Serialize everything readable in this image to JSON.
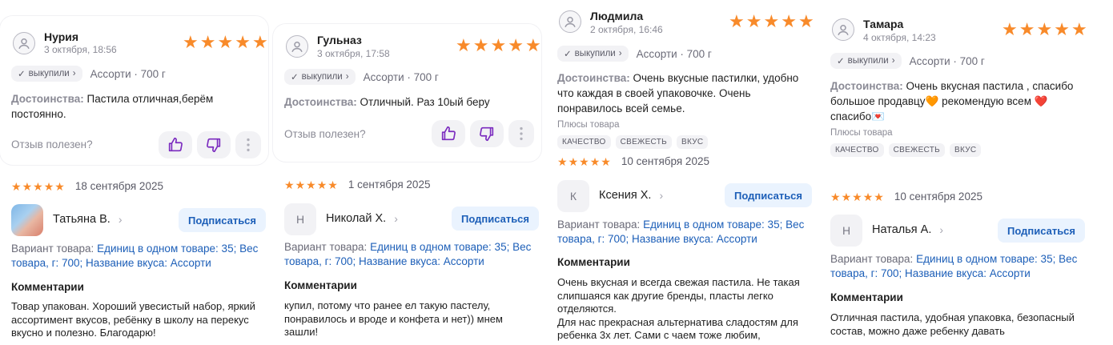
{
  "colors": {
    "star": "#f88a2a",
    "link": "#1d5fb8",
    "subscribe_bg": "#eaf3fe",
    "thumb": "#7b2bbf"
  },
  "icons": {
    "avatar": "user-circle-icon",
    "like": "thumb-up-icon",
    "dislike": "thumb-down-icon",
    "more": "more-vertical-icon",
    "check": "check-icon",
    "chevron": "chevron-right-icon"
  },
  "common": {
    "bought_label": "выкупили",
    "variant_short": "Ассорти · 700 г",
    "pros_prefix": "Достоинства:",
    "helpful_label": "Отзыв полезен?",
    "subscribe_label": "Подписаться",
    "variant_prefix": "Вариант товара:",
    "comments_title": "Комментарии",
    "pros_tags_title": "Плюсы товара",
    "star": "★",
    "chevron": "›",
    "check": "✓"
  },
  "reviews": [
    {
      "author": "Нурия",
      "date": "3 октября, 18:56",
      "rating": 5,
      "pros_text": "Пастила отличная,берём постоянно."
    },
    {
      "author": "Гульназ",
      "date": "3 октября, 17:58",
      "rating": 5,
      "pros_text": "Отличный. Раз 10ый беру"
    },
    {
      "author": "Людмила",
      "date": "2 октября, 16:46",
      "rating": 5,
      "pros_text": "Очень вкусные пастилки, удобно что каждая в своей упаковочке. Очень понравилось всей семье.",
      "tags": [
        "КАЧЕСТВО",
        "СВЕЖЕСТЬ",
        "ВКУС"
      ]
    },
    {
      "author": "Тамара",
      "date": "4 октября, 14:23",
      "rating": 5,
      "pros_text": "Очень вкусная пастила , спасибо большое продавцу🧡 рекомендую всем ❤️ спасибо💌",
      "tags": [
        "КАЧЕСТВО",
        "СВЕЖЕСТЬ",
        "ВКУС"
      ]
    }
  ],
  "comments": [
    {
      "date": "18 сентября 2025",
      "rating": 5,
      "initial": "",
      "user": "Татьяна В.",
      "variant": "Единиц в одном товаре: 35; Вес товара, г: 700; Название вкуса: Ассорти",
      "text": "Товар упакован. Хороший увесистый набор, яркий ассортимент вкусов, ребёнку в школу на перекус вкусно и полезно. Благодарю!"
    },
    {
      "date": "1 сентября 2025",
      "rating": 5,
      "initial": "Н",
      "user": "Николай Х.",
      "variant": "Единиц в одном товаре: 35; Вес товара, г: 700; Название вкуса: Ассорти",
      "text": "купил, потому что ранее ел такую пастелу, понравилось и вроде и конфета и нет)) мнем зашли!"
    },
    {
      "date": "10 сентября 2025",
      "rating": 5,
      "initial": "К",
      "user": "Ксения Х.",
      "variant": "Единиц в одном товаре: 35; Вес товара, г: 700; Название вкуса: Ассорти",
      "text": "Очень вкусная и всегда свежая пастила. Не такая слипшаяся как другие бренды, пласты легко отделяются.\nДля нас прекрасная альтернатива сладостям для ребенка 3х лет. Сами с чаем тоже любим,"
    },
    {
      "date": "10 сентября 2025",
      "rating": 5,
      "initial": "Н",
      "user": "Наталья А.",
      "variant": "Единиц в одном товаре: 35; Вес товара, г: 700; Название вкуса: Ассорти",
      "text": "Отличная пастила, удобная упаковка, безопасный состав, можно даже ребенку давать"
    }
  ]
}
